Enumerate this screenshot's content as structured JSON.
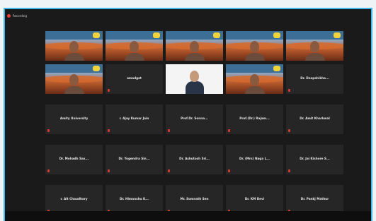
{
  "app": {
    "recording_label": "Recording"
  },
  "tiles": [
    {
      "name": "",
      "video": true,
      "caption": ""
    },
    {
      "name": "",
      "video": true,
      "caption": ""
    },
    {
      "name": "",
      "video": true,
      "caption": ""
    },
    {
      "name": "",
      "video": true,
      "caption": ""
    },
    {
      "name": "",
      "video": true,
      "caption": ""
    },
    {
      "name": "",
      "video": true,
      "caption": "",
      "active": true
    },
    {
      "name": "amadget",
      "video": false
    },
    {
      "name": "",
      "video": true,
      "caption": "",
      "plain": true
    },
    {
      "name": "",
      "video": true,
      "caption": ""
    },
    {
      "name": "Dr. Deepshikha...",
      "video": false
    },
    {
      "name": "Amity University",
      "video": false
    },
    {
      "name": "r. Ajay Kumar Jain",
      "video": false
    },
    {
      "name": "Prof.Dr. Sonna...",
      "video": false
    },
    {
      "name": "Prof.(Dr.) Rajam...",
      "video": false
    },
    {
      "name": "Dr. Amit Kharkwal",
      "video": false
    },
    {
      "name": "Dr. Mohadh Sax...",
      "video": false
    },
    {
      "name": "Dr. Yogendra Sin...",
      "video": false
    },
    {
      "name": "Dr. Ashutosh Sri...",
      "video": false
    },
    {
      "name": "Dr. (Mrs) Naga L...",
      "video": false
    },
    {
      "name": "Dr. Jai Kishore S...",
      "video": false
    },
    {
      "name": "r. Alt Chaudhary",
      "video": false
    },
    {
      "name": "Dr. Himanshu K...",
      "video": false
    },
    {
      "name": "Mr. Somnath Sen",
      "video": false
    },
    {
      "name": "Dr. KM Devi",
      "video": false
    },
    {
      "name": "Dr. Pankj Mathur",
      "video": false
    }
  ]
}
